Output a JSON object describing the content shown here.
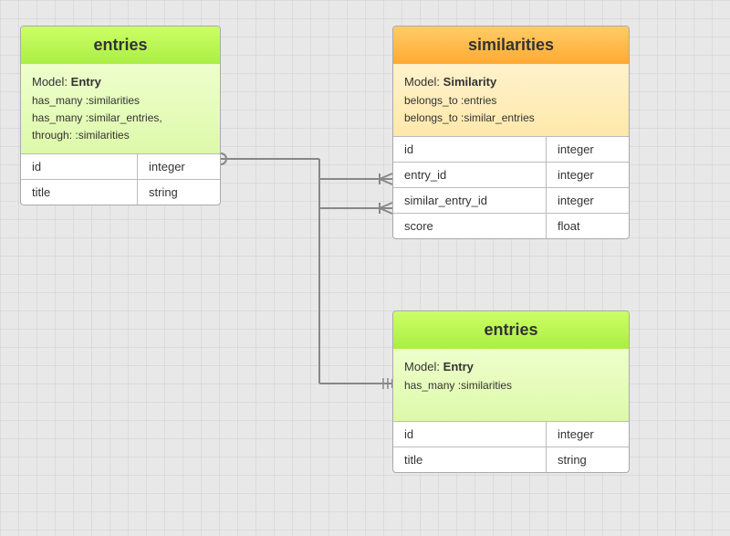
{
  "tables": {
    "entries_left": {
      "header": "entries",
      "model_label": "Model:",
      "model_name": "Entry",
      "relations": [
        "has_many :similarities",
        "has_many :similar_entries,",
        "through: :similarities"
      ],
      "rows": [
        {
          "name": "id",
          "type": "integer"
        },
        {
          "name": "title",
          "type": "string"
        }
      ]
    },
    "similarities": {
      "header": "similarities",
      "model_label": "Model:",
      "model_name": "Similarity",
      "relations": [
        "belongs_to :entries",
        "belongs_to :similar_entries"
      ],
      "rows": [
        {
          "name": "id",
          "type": "integer"
        },
        {
          "name": "entry_id",
          "type": "integer"
        },
        {
          "name": "similar_entry_id",
          "type": "integer"
        },
        {
          "name": "score",
          "type": "float"
        }
      ]
    },
    "entries_right": {
      "header": "entries",
      "model_label": "Model:",
      "model_name": "Entry",
      "relations": [
        "has_many :similarities"
      ],
      "rows": [
        {
          "name": "id",
          "type": "integer"
        },
        {
          "name": "title",
          "type": "string"
        }
      ]
    }
  }
}
